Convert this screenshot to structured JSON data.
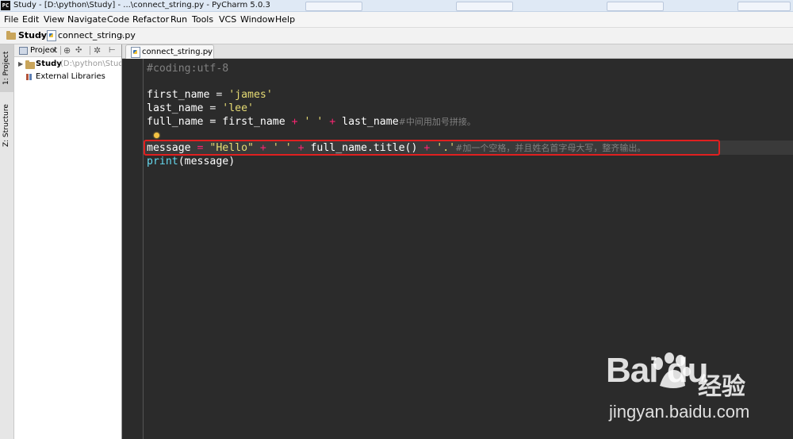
{
  "window": {
    "title": "Study - [D:\\python\\Study] - ...\\connect_string.py - PyCharm 5.0.3",
    "app_icon": "PC"
  },
  "menu": [
    "File",
    "Edit",
    "View",
    "Navigate",
    "Code",
    "Refactor",
    "Run",
    "Tools",
    "VCS",
    "Window",
    "Help"
  ],
  "breadcrumb": {
    "project": "Study",
    "file": "connect_string.py",
    "separator": "›"
  },
  "toolstrip": {
    "project_tab": "1: Project",
    "structure_tab": "Z: Structure"
  },
  "project_panel": {
    "view_selector": "Project",
    "root_name": "Study",
    "root_path": "(D:\\python\\Study)",
    "libraries": "External Libraries"
  },
  "editor": {
    "tab_label": "connect_string.py",
    "lines": {
      "l1": "#coding:utf-8",
      "l3_var": "first_name",
      "l3_eq": " = ",
      "l3_str": "'james'",
      "l4_var": "last_name",
      "l4_eq": " = ",
      "l4_str": "'lee'",
      "l5_a": "full_name = first_name ",
      "l5_op1": "+",
      "l5_str": " ' ' ",
      "l5_op2": "+",
      "l5_b": " last_name",
      "l5_comment": "#中间用加号拼接。",
      "l7_var": "message",
      "l7_eq": " = ",
      "l7_str1": "\"Hello\"",
      "l7_op1": " + ",
      "l7_str2": "' '",
      "l7_op2": " + ",
      "l7_expr": "full_name.title()",
      "l7_op3": " + ",
      "l7_str3": "'.'",
      "l7_comment": "#加一个空格，并且姓名首字母大写，整齐输出。",
      "l8_fn": "print",
      "l8_args": "(message)"
    }
  },
  "watermark": {
    "brand": "Bai du",
    "chinese": "经验",
    "url": "jingyan.baidu.com"
  },
  "colors": {
    "editor_bg": "#2b2b2b",
    "string": "#e6db74",
    "operator": "#f92672",
    "comment": "#808080",
    "highlight_box": "#e02020"
  }
}
